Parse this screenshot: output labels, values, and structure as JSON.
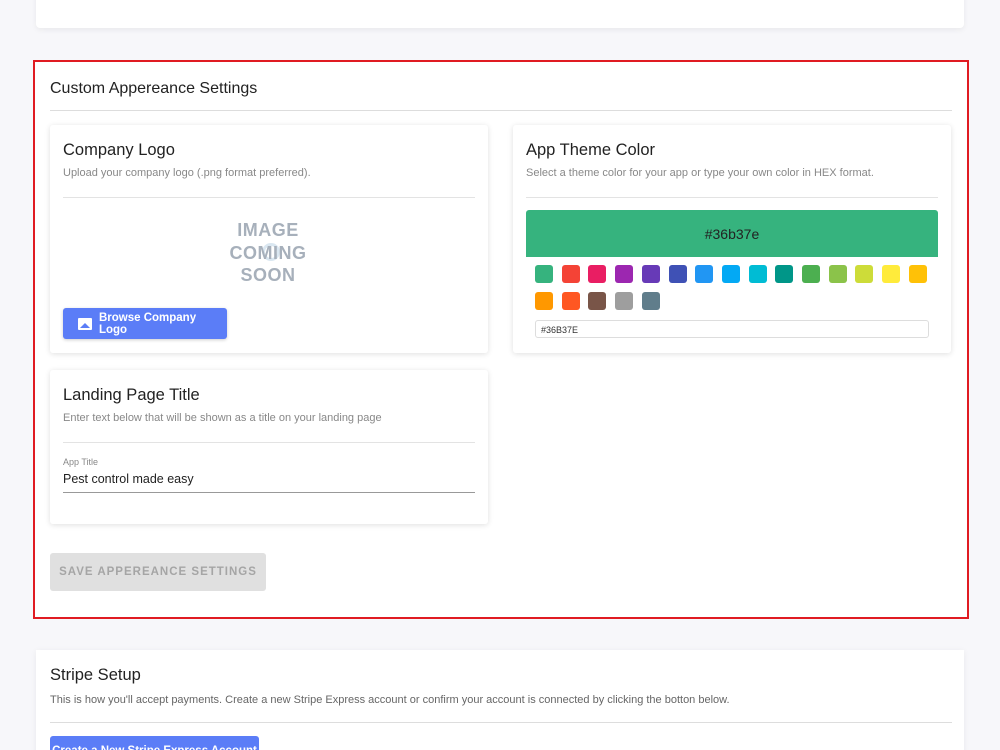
{
  "appearance": {
    "title": "Custom Appereance Settings",
    "company_logo": {
      "title": "Company Logo",
      "subtitle": "Upload your company logo (.png format preferred).",
      "placeholder_lines": [
        "IMAGE",
        "COMING",
        "SOON"
      ],
      "browse_label": "Browse Company Logo",
      "browse_icon": "image-icon"
    },
    "landing_title": {
      "title": "Landing Page Title",
      "subtitle": "Enter text below that will be shown as a title on your landing page",
      "field_label": "App Title",
      "field_value": "Pest control made easy"
    },
    "theme_color": {
      "title": "App Theme Color",
      "subtitle": "Select a theme color for your app or type your own color in HEX format.",
      "preview_label": "#36b37e",
      "preview_color": "#36b37e",
      "hex_value": "#36B37E",
      "swatches": [
        "#36b37e",
        "#f44336",
        "#e91e63",
        "#9c27b0",
        "#673ab7",
        "#3f51b5",
        "#2196f3",
        "#03a9f4",
        "#00bcd4",
        "#009688",
        "#4caf50",
        "#8bc34a",
        "#cddc39",
        "#ffeb3b",
        "#ffc107",
        "#ff9800",
        "#ff5722",
        "#795548",
        "#9e9e9e",
        "#607d8b"
      ]
    },
    "save_label": "SAVE APPEREANCE SETTINGS"
  },
  "stripe": {
    "title": "Stripe Setup",
    "subtitle": "This is how you'll accept payments. Create a new Stripe Express account or confirm your account is connected by clicking the botton below.",
    "button_label": "Create a New Stripe Express Account"
  }
}
